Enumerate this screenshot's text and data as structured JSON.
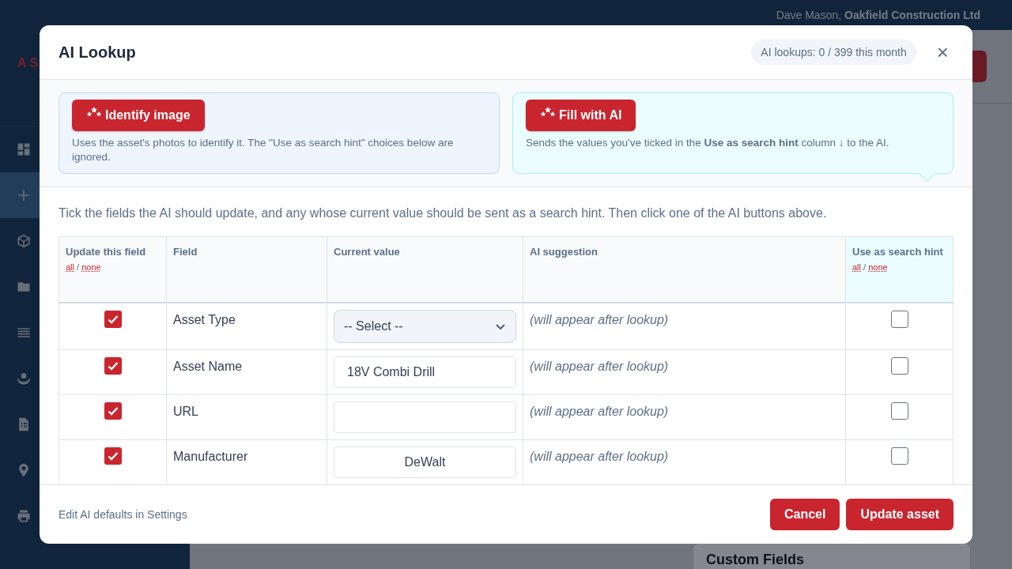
{
  "top_bar": {
    "user": "Dave Mason,",
    "company": "Oakfield Construction Ltd"
  },
  "sidebar": {
    "logo": "AS",
    "items": [
      {
        "kind": "dashboard",
        "selected": false
      },
      {
        "kind": "plus",
        "selected": true
      },
      {
        "kind": "cube",
        "selected": false
      },
      {
        "kind": "folder",
        "selected": false
      },
      {
        "kind": "list",
        "selected": false
      },
      {
        "kind": "people",
        "selected": false
      },
      {
        "kind": "document",
        "selected": false
      },
      {
        "kind": "pin",
        "selected": false
      },
      {
        "kind": "printer",
        "selected": false
      }
    ]
  },
  "background": {
    "custom_fields_heading": "Custom Fields"
  },
  "modal": {
    "title": "AI Lookup",
    "usage": "AI lookups: 0 / 399 this month",
    "close": "×",
    "ai_actions": [
      {
        "kind": "image",
        "label": "Identify image",
        "description": "Uses the asset's photos to identify it. The \"Use as search hint\" choices below are ignored."
      },
      {
        "kind": "fill",
        "label": "Fill with AI",
        "description": "Sends the values you've ticked in the **Use as search hint** column ↓ to the AI."
      }
    ],
    "intro": "Tick the fields the AI should update, and any whose current value should be sent as a search hint. Then click one of the AI buttons above.",
    "table": {
      "columns": [
        {
          "label": "Update this field",
          "all": "all",
          "separator": "/",
          "none": "none",
          "highlighted": false
        },
        {
          "label": "Field",
          "highlighted": false
        },
        {
          "label": "Current value",
          "highlighted": false
        },
        {
          "label": "AI suggestion",
          "highlighted": false
        },
        {
          "label": "Use as search hint",
          "all": "all",
          "separator": "/",
          "none": "none",
          "highlighted": true
        }
      ],
      "rows": [
        {
          "update": true,
          "field": "Asset Type",
          "kind": "select",
          "value": "-- Select --",
          "suggestion": "(will appear after lookup)",
          "hint": false
        },
        {
          "update": true,
          "field": "Asset Name",
          "kind": "text",
          "value": "18V Combi Drill",
          "suggestion": "(will appear after lookup)",
          "hint": false
        },
        {
          "update": true,
          "field": "URL",
          "kind": "text",
          "suggestion": "(will appear after lookup)",
          "hint": false
        },
        {
          "update": true,
          "field": "Manufacturer",
          "kind": "centered",
          "value": "DeWalt",
          "suggestion": "(will appear after lookup)",
          "hint": false
        }
      ]
    },
    "footer": {
      "settings_link": "Edit AI defaults in Settings",
      "buttons": [
        "Cancel",
        "Update asset"
      ]
    }
  }
}
